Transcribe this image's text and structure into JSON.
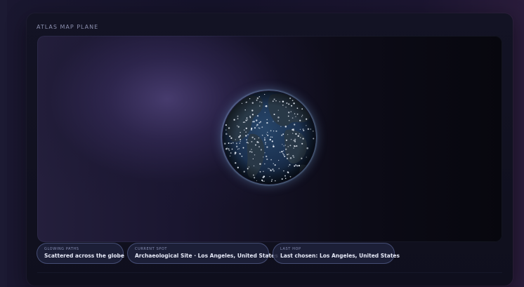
{
  "panel": {
    "title": "ATLAS MAP PLANE"
  },
  "globe": {
    "icon": "globe-icon",
    "ocean_color": "#1d3350",
    "land_color": "#2a3a4a",
    "dot_color": "#e6ecf5",
    "glow_color": "#78aadc"
  },
  "chips": [
    {
      "label": "GLOWING PATHS",
      "value": "Scattered across the globe"
    },
    {
      "label": "CURRENT SPOT",
      "value": "Archaeological Site · Los Angeles, United States"
    },
    {
      "label": "LAST HOP",
      "value": "Last chosen: Los Angeles, United States"
    }
  ]
}
